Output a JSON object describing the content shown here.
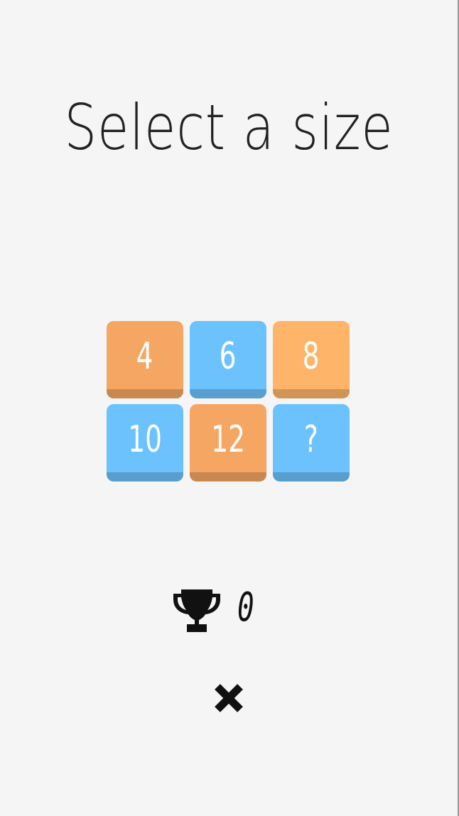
{
  "title": "Select a size",
  "sizes": [
    {
      "label": "4",
      "color": "#f4a662"
    },
    {
      "label": "6",
      "color": "#6cc2fd"
    },
    {
      "label": "8",
      "color": "#feb56a"
    },
    {
      "label": "10",
      "color": "#6cc2fd"
    },
    {
      "label": "12",
      "color": "#f4a662"
    },
    {
      "label": "?",
      "color": "#6cc2fd"
    }
  ],
  "best_score": "0",
  "icons": {
    "trophy": "trophy-icon",
    "close": "close-icon"
  }
}
